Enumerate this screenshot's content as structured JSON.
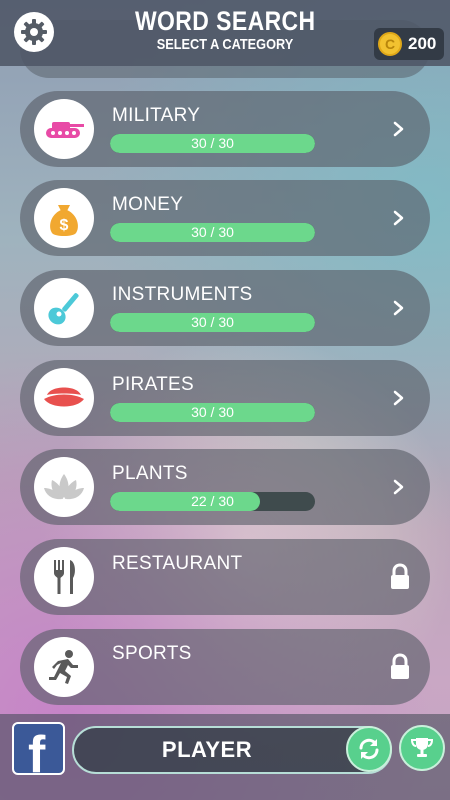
{
  "header": {
    "title": "WORD SEARCH",
    "subtitle": "SELECT A CATEGORY",
    "coins": "200",
    "coin_symbol": "C",
    "settings_icon": "gear-icon"
  },
  "categories": [
    {
      "label": "MILITARY",
      "progress_text": "30 / 30",
      "completed": 30,
      "total": 30,
      "locked": false,
      "icon": "tank-icon"
    },
    {
      "label": "MONEY",
      "progress_text": "30 / 30",
      "completed": 30,
      "total": 30,
      "locked": false,
      "icon": "money-bag-icon"
    },
    {
      "label": "INSTRUMENTS",
      "progress_text": "30 / 30",
      "completed": 30,
      "total": 30,
      "locked": false,
      "icon": "guitar-icon"
    },
    {
      "label": "PIRATES",
      "progress_text": "30 / 30",
      "completed": 30,
      "total": 30,
      "locked": false,
      "icon": "pirate-hat-icon"
    },
    {
      "label": "PLANTS",
      "progress_text": "22 / 30",
      "completed": 22,
      "total": 30,
      "locked": false,
      "icon": "lotus-icon"
    },
    {
      "label": "RESTAURANT",
      "locked": true,
      "icon": "fork-knife-icon"
    },
    {
      "label": "SPORTS",
      "locked": true,
      "icon": "runner-icon"
    }
  ],
  "footer": {
    "facebook_letter": "f",
    "player_name": "PLAYER",
    "refresh_icon": "refresh-icon",
    "trophy_icon": "trophy-icon"
  },
  "colors": {
    "progress_fill": "#6cd88c",
    "progress_track": "#3f4b4d",
    "accent_green": "#58d08d",
    "facebook_blue": "#3b5998",
    "coin_gold": "#f2c230"
  }
}
